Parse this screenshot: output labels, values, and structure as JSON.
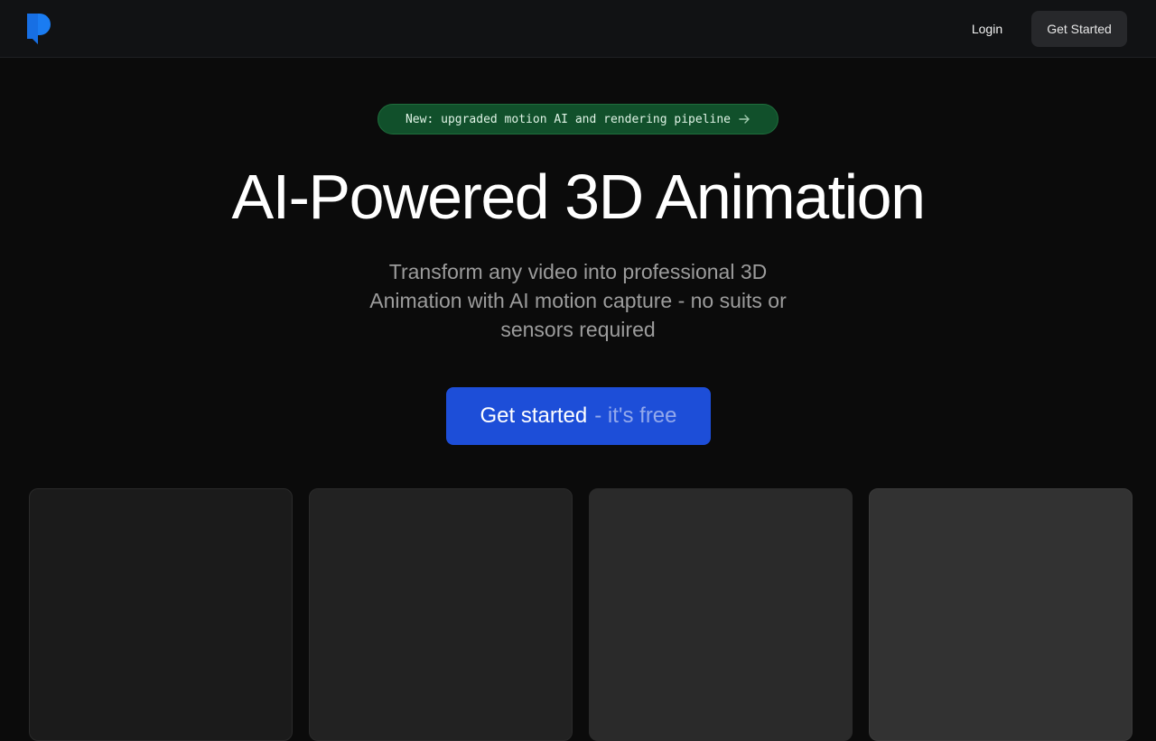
{
  "nav": {
    "logo_icon": "brand-logo-icon",
    "login_label": "Login",
    "cta_label": "Get Started"
  },
  "announcement": {
    "text": "New: upgraded motion AI and rendering pipeline",
    "icon": "arrow-right-icon"
  },
  "hero": {
    "title": "AI-Powered 3D Animation",
    "subtitle": "Transform any video into professional 3D Animation with AI motion capture - no suits or sensors required",
    "cta_main": "Get started",
    "cta_suffix": "- it's free"
  },
  "colors": {
    "accent": "#1d4ed8",
    "logo": "#1a7cf2",
    "badge_bg": "#11502b"
  }
}
